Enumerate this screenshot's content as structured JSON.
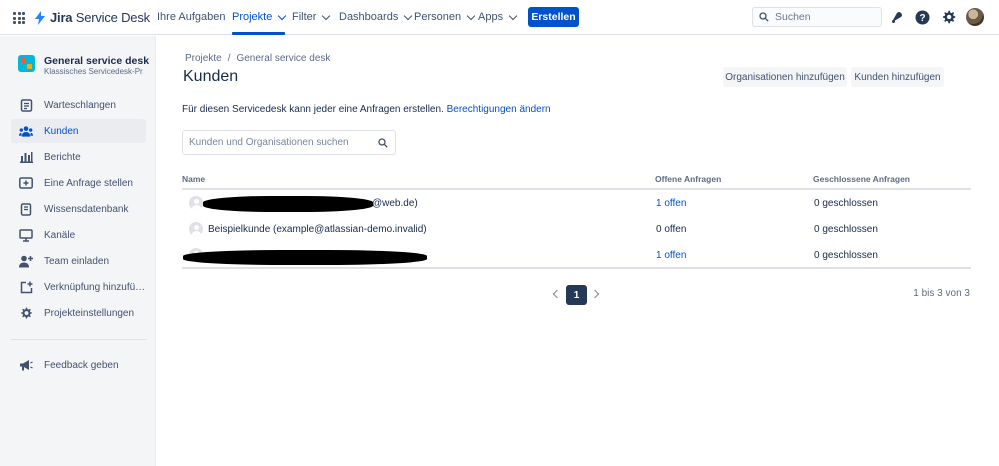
{
  "topnav": {
    "logo_text_bold": "Jira",
    "logo_text_light": " Service Desk",
    "items": [
      {
        "label": "Ihre Aufgaben"
      },
      {
        "label": "Projekte"
      },
      {
        "label": "Filter"
      },
      {
        "label": "Dashboards"
      },
      {
        "label": "Personen"
      },
      {
        "label": "Apps"
      }
    ],
    "create_label": "Erstellen",
    "search_placeholder": "Suchen"
  },
  "sidebar": {
    "project_name": "General service desk",
    "project_type": "Klassisches Servicedesk-Pr…",
    "items": [
      {
        "label": "Warteschlangen",
        "icon": "queue-icon"
      },
      {
        "label": "Kunden",
        "icon": "people-icon",
        "active": true
      },
      {
        "label": "Berichte",
        "icon": "chart-icon"
      },
      {
        "label": "Eine Anfrage stellen",
        "icon": "request-icon"
      },
      {
        "label": "Wissensdatenbank",
        "icon": "book-icon"
      },
      {
        "label": "Kanäle",
        "icon": "monitor-icon"
      },
      {
        "label": "Team einladen",
        "icon": "person-add-icon"
      },
      {
        "label": "Verknüpfung hinzufü…",
        "icon": "shortcut-icon"
      },
      {
        "label": "Projekteinstellungen",
        "icon": "gear-icon"
      }
    ],
    "feedback_label": "Feedback geben"
  },
  "main": {
    "breadcrumb": [
      "Projekte",
      "/",
      "General service desk"
    ],
    "title": "Kunden",
    "add_org_label": "Organisationen hinzufügen",
    "add_customer_label": "Kunden hinzufügen",
    "info_text": "Für diesen Servicedesk kann jeder eine Anfragen erstellen.",
    "info_link": "Berechtigungen ändern",
    "search_placeholder": "Kunden und Organisationen suchen",
    "columns": [
      "Name",
      "Offene Anfragen",
      "Geschlossene Anfragen"
    ],
    "rows": [
      {
        "name": "@web.de)",
        "open": "1 offen",
        "closed": "0 geschlossen",
        "redacted": true
      },
      {
        "name": "Beispielkunde (example@atlassian-demo.invalid)",
        "open": "0 offen",
        "closed": "0 geschlossen",
        "redacted": false
      },
      {
        "name": "",
        "open": "1 offen",
        "closed": "0 geschlossen",
        "redacted": true
      }
    ],
    "pagination": {
      "current_page": "1",
      "count_text": "1 bis 3 von 3"
    }
  },
  "colors": {
    "accent": "#0052cc",
    "sidebar_bg": "#f4f5f7",
    "text": "#172b4d"
  }
}
